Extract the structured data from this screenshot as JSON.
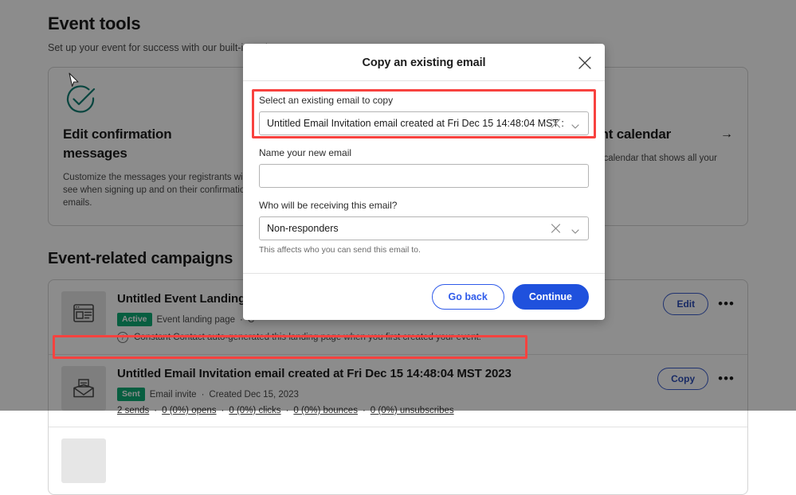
{
  "page": {
    "title": "Event tools",
    "subtitle": "Set up your event for success with our built-in tools.",
    "section_title": "Event-related campaigns"
  },
  "tool_cards": [
    {
      "icon": "check-circle-icon",
      "title": "Edit confirmation messages",
      "arrow": "→",
      "description": "Customize the messages your registrants will see when signing up and on their confirmation emails."
    },
    {
      "icon": "hidden-card-icon",
      "title": "",
      "arrow": "→",
      "description": ""
    },
    {
      "icon": "calendar-icon",
      "title": "Share event calendar",
      "arrow": "→",
      "description": "Give contacts a calendar that shows all your events."
    }
  ],
  "campaigns": [
    {
      "thumb_icon": "landing-page-icon",
      "title": "Untitled Event Landing",
      "badge": "Active",
      "type": "Event landing page",
      "separator": "·",
      "created": "C",
      "note": "Constant Contact auto-generated this landing page when you first created your event.",
      "note_icon": "info-icon",
      "action_label": "Edit",
      "kebab": "•••"
    },
    {
      "thumb_icon": "email-invite-icon",
      "title": "Untitled Email Invitation email created at Fri Dec 15 14:48:04 MST 2023",
      "badge": "Sent",
      "type": "Email invite",
      "separator": "·",
      "created": "Created Dec 15, 2023",
      "stats": [
        "2 sends",
        "0 (0%) opens",
        "0 (0%) clicks",
        "0 (0%) bounces",
        "0 (0%) unsubscribes"
      ],
      "action_label": "Copy",
      "kebab": "•••"
    }
  ],
  "modal": {
    "title": "Copy an existing email",
    "close_icon": "close-icon",
    "fields": {
      "source_email": {
        "label": "Select an existing email to copy",
        "value": "Untitled Email Invitation email created at Fri Dec 15 14:48:04 MST :",
        "clear_icon": "clear-icon",
        "caret_icon": "chevron-down-icon"
      },
      "new_email_name": {
        "label": "Name your new email",
        "value": "",
        "placeholder": ""
      },
      "recipients": {
        "label": "Who will be receiving this email?",
        "value": "Non-responders",
        "help": "This affects who you can send this email to.",
        "clear_icon": "clear-icon",
        "caret_icon": "chevron-down-icon"
      }
    },
    "buttons": {
      "back": "Go back",
      "continue": "Continue"
    }
  },
  "colors": {
    "primary": "#1f51dd",
    "secondary_border": "#2f5bea",
    "accent_teal": "#0e7f73",
    "badge_green": "#0dab76",
    "annotation_red": "#f8423f"
  }
}
